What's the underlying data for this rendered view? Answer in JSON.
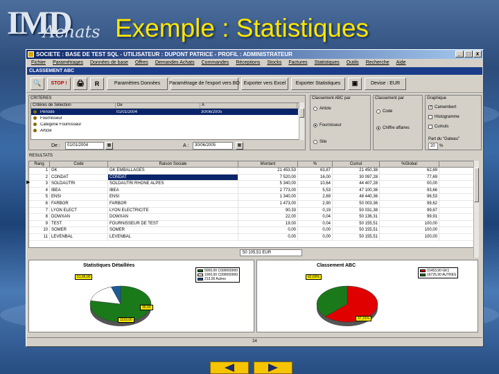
{
  "slide": {
    "logo_main": "IMD",
    "logo_sub": "Achats",
    "title": "Exemple : Statistiques"
  },
  "window": {
    "title": "SOCIETE : BASE DE TEST SQL - UTILISATEUR : DUPONT PATRICE - PROFIL : ADMINISTRATEUR",
    "min": "_",
    "max": "□",
    "close": "x",
    "menu": [
      "Fichier",
      "Paramétrages",
      "Données de base",
      "Offres",
      "Demandes Achats",
      "Commandes",
      "Réceptions",
      "Stocks",
      "Factures",
      "Statistiques",
      "Outils",
      "Recherche",
      "Aide"
    ],
    "section": "CLASSEMENT ABC",
    "status": "24"
  },
  "toolbar": {
    "binoculars": "🔍",
    "stop": "STOP !",
    "print": "🖨",
    "r": "R",
    "btn1": "Paramètres Données",
    "btn2": "Paramétrage de l'export vers BO",
    "btn3": "Exporter vers Excel",
    "btn4": "Exporter Statistiques",
    "devise_icon": "▣",
    "devise": "Devise : EUR"
  },
  "criteria": {
    "header": "CRITERES",
    "cols": [
      "Critères de Sélection",
      "De",
      "A"
    ],
    "rows": [
      {
        "label": "Période",
        "de": "01/01/2004",
        "a": "30/06/2005",
        "selected": true
      },
      {
        "label": "Fournisseur",
        "de": "",
        "a": "",
        "selected": false
      },
      {
        "label": "Catégorie Fournisseur",
        "de": "",
        "a": "",
        "selected": false
      },
      {
        "label": "Article",
        "de": "",
        "a": "",
        "selected": false
      }
    ],
    "de_label": "De :",
    "de_value": "01/01/2004",
    "a_label": "A :",
    "a_value": "30/06/2005",
    "cal_icon": "▦"
  },
  "abc_par": {
    "label": "Classement ABC par",
    "options": [
      "Article",
      "Fournisseur",
      "Site"
    ],
    "selected": "Fournisseur"
  },
  "abc_sur": {
    "label": "Classement par",
    "options": [
      "Code",
      "Chiffre affaires"
    ],
    "selected": "Chiffre affaires"
  },
  "graphic": {
    "label": "Graphique",
    "options": [
      {
        "label": "Camembert",
        "checked": true
      },
      {
        "label": "Histogramme",
        "checked": false
      },
      {
        "label": "Cumuls",
        "checked": false
      }
    ],
    "part_label": "Part du \"Gateau\"",
    "part_value": "20",
    "part_unit": "%"
  },
  "results": {
    "header": "RESULTATS",
    "cols": [
      "Rang",
      "Code",
      "Raison Sociale",
      "Montant",
      "%",
      "Cumul",
      "%Global"
    ],
    "rows": [
      [
        "1",
        "GK",
        "GK EMBALLAGES",
        "21 453,53",
        "63,87",
        "21 450,38",
        "62,69"
      ],
      [
        "2",
        "CONDAT",
        "CONDAT",
        "7 520,00",
        "16,00",
        "30 097,28",
        "77,69"
      ],
      [
        "3",
        "SOLDAUTRI",
        "SOLDAUTRI RHONE ALPES",
        "5 340,00",
        "10,64",
        "44 407,28",
        "00,00"
      ],
      [
        "4",
        "IBEA",
        "IBEA",
        "2 773,00",
        "5,53",
        "47 100,36",
        "93,66"
      ],
      [
        "5",
        "ENSI",
        "ENSI",
        "1 340,00",
        "2,69",
        "48 440,36",
        "96,53"
      ],
      [
        "6",
        "FARBOR",
        "FARBOR",
        "1 473,00",
        "2,90",
        "50 003,36",
        "99,62"
      ],
      [
        "7",
        "LYON ELECT",
        "LYON ELECTRICITE",
        "90,33",
        "0,19",
        "50 031,38",
        "99,67"
      ],
      [
        "8",
        "DOWXAN",
        "DOWXAN",
        "22,00",
        "0,04",
        "50 136,31",
        "99,91"
      ],
      [
        "9",
        "TEST",
        "FOURNISSEUR DE TEST",
        "19,00",
        "0,04",
        "50 155,51",
        "100,00"
      ],
      [
        "10",
        "SOMER",
        "SOMER",
        "0,00",
        "0,00",
        "50 155,51",
        "100,00"
      ],
      [
        "11",
        "LEVENBAL",
        "LEVENBAL",
        "0,00",
        "0,00",
        "50 155,51",
        "100,00"
      ]
    ],
    "total": "50 105,51 EUR"
  },
  "chart_left": {
    "title": "Statistiques Détaillées",
    "legend": [
      {
        "label": "5000,00 C000000000",
        "color": "#1a7a1a"
      },
      {
        "label": "1000,00 C000000000",
        "color": "#ffffff"
      },
      {
        "label": "213,00 Autres",
        "color": "#1a5c9a"
      }
    ],
    "tag1": "51,66,00",
    "tag2": "30,00",
    "tag3": "1153,00"
  },
  "chart_right": {
    "title": "Classement ABC",
    "legend": [
      {
        "label": "31453,90 GK1",
        "color": "#e00000"
      },
      {
        "label": "16725,90 AUTRES",
        "color": "#1a7a1a"
      }
    ],
    "tag1": "62,69%",
    "tag2": "37,31%"
  },
  "chart_data": [
    {
      "type": "pie",
      "title": "Statistiques Détaillées",
      "categories": [
        "5000,00 C000000000",
        "1000,00 C000000000",
        "213,00 Autres"
      ],
      "values": [
        78,
        17,
        5
      ]
    },
    {
      "type": "pie",
      "title": "Classement ABC",
      "categories": [
        "31453,90 GK1",
        "16725,90 AUTRES"
      ],
      "values": [
        62.69,
        37.31
      ]
    }
  ],
  "nav": {
    "prev": "◀",
    "next": "▶"
  }
}
